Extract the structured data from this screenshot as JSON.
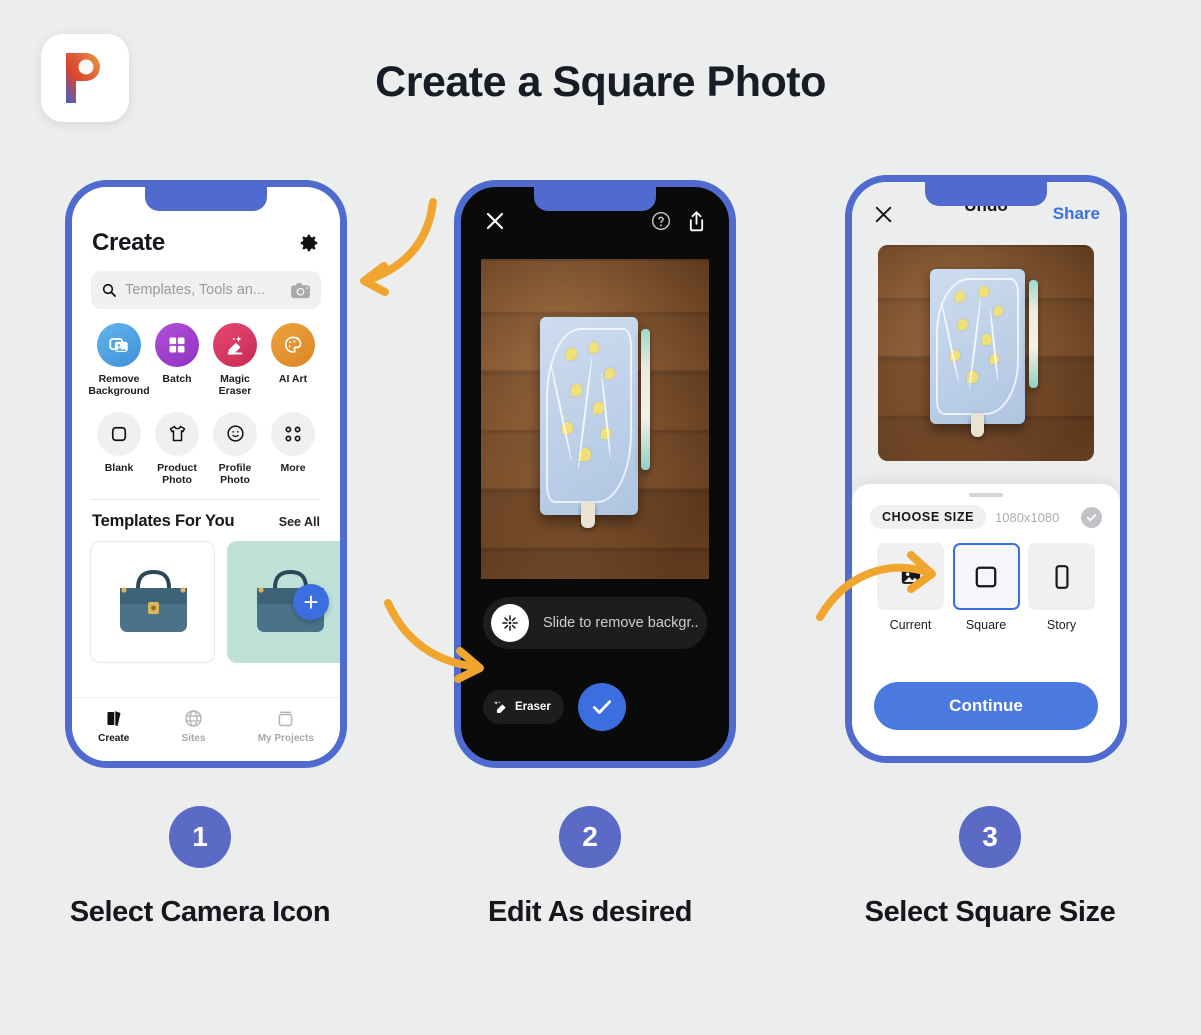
{
  "header": {
    "logo_letter": "P",
    "logo_name": "picsart-logo",
    "title": "Create a Square Photo"
  },
  "phone1": {
    "screen_title": "Create",
    "gear_icon": "gear-icon",
    "search": {
      "placeholder": "Templates, Tools an...",
      "search_icon": "search-icon",
      "camera_icon": "camera-icon"
    },
    "tools_row1": [
      {
        "label": "Remove Background",
        "icon": "photos-icon",
        "color": "#4fa3e0"
      },
      {
        "label": "Batch",
        "icon": "grid-icon",
        "color": "#a93ecf"
      },
      {
        "label": "Magic Eraser",
        "icon": "magic-eraser-icon",
        "color": "#dc3a63"
      },
      {
        "label": "AI Art",
        "icon": "ai-art-icon",
        "color": "#e8962f"
      }
    ],
    "tools_row2": [
      {
        "label": "Blank",
        "icon": "square-icon"
      },
      {
        "label": "Product Photo",
        "icon": "tshirt-icon"
      },
      {
        "label": "Profile Photo",
        "icon": "smiley-icon"
      },
      {
        "label": "More",
        "icon": "more-grid-icon"
      }
    ],
    "templates": {
      "title": "Templates For You",
      "see_all": "See All",
      "cards": [
        {
          "name": "handbag-template-white",
          "bg": "#ffffff"
        },
        {
          "name": "handbag-template-mint",
          "bg": "#bfe1d8"
        }
      ],
      "add_label": "+"
    },
    "tabbar": [
      {
        "label": "Create",
        "icon": "cards-icon",
        "active": true
      },
      {
        "label": "Sites",
        "icon": "globe-icon",
        "active": false
      },
      {
        "label": "My Projects",
        "icon": "folder-icon",
        "active": false
      }
    ]
  },
  "phone2": {
    "close_icon": "close-icon",
    "help_icon": "help-circle-icon",
    "share_icon": "share-icon",
    "slider_label": "Slide to remove backgr...",
    "slider_icon": "sparkle-burst-icon",
    "eraser_label": "Eraser",
    "eraser_icon": "eraser-icon",
    "confirm_icon": "check-icon"
  },
  "phone3": {
    "close_icon": "close-icon",
    "undo_label": "Undo",
    "share_label": "Share",
    "sheet": {
      "size_label": "CHOOSE SIZE",
      "dimensions": "1080x1080",
      "check_icon": "check-badge-icon",
      "options": [
        {
          "label": "Current",
          "icon": "image-icon",
          "selected": false
        },
        {
          "label": "Square",
          "icon": "square-icon",
          "selected": true
        },
        {
          "label": "Story",
          "icon": "story-rect-icon",
          "selected": false
        }
      ],
      "continue_label": "Continue"
    }
  },
  "steps": [
    {
      "number": "1",
      "caption": "Select Camera Icon"
    },
    {
      "number": "2",
      "caption": "Edit As desired"
    },
    {
      "number": "3",
      "caption": "Select Square Size"
    }
  ],
  "colors": {
    "background": "#eceded",
    "phone_frame": "#4f6bd0",
    "accent_blue": "#3b6fe0",
    "arrow_orange": "#f0a52e",
    "step_circle": "#5b6ac4"
  }
}
